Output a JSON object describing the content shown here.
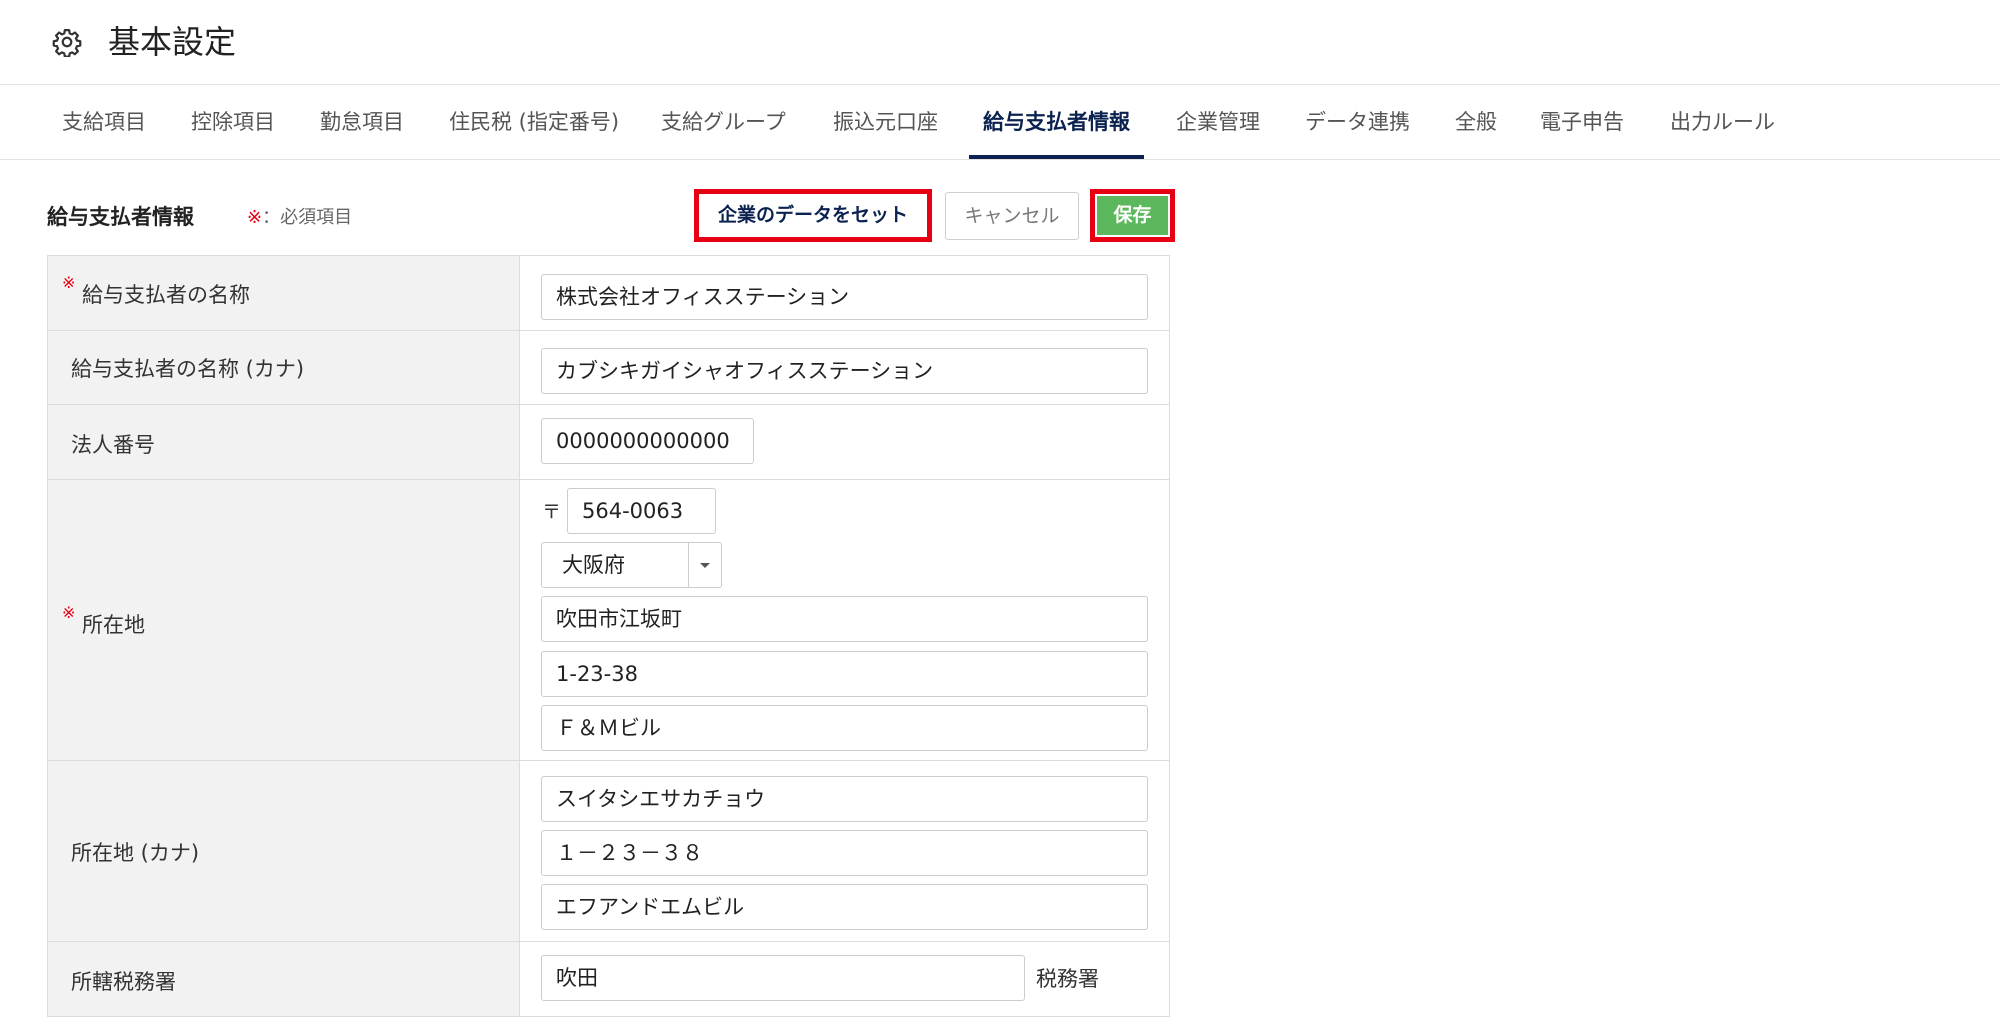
{
  "header": {
    "title": "基本設定",
    "icon": "gear-icon"
  },
  "tabs": [
    {
      "label": "支給項目"
    },
    {
      "label": "控除項目"
    },
    {
      "label": "勤怠項目"
    },
    {
      "label": "住民税 (指定番号)"
    },
    {
      "label": "支給グループ"
    },
    {
      "label": "振込元口座"
    },
    {
      "label": "給与支払者情報",
      "active": true
    },
    {
      "label": "企業管理"
    },
    {
      "label": "データ連携"
    },
    {
      "label": "全般"
    },
    {
      "label": "電子申告"
    },
    {
      "label": "出力ルール"
    }
  ],
  "section": {
    "title": "給与支払者情報",
    "required_mark": "※",
    "required_text": "：必須項目"
  },
  "buttons": {
    "set_company_data": "企業のデータをセット",
    "cancel": "キャンセル",
    "save": "保存"
  },
  "form": {
    "name": {
      "label": "給与支払者の名称",
      "required_mark": "※",
      "value": "株式会社オフィスステーション"
    },
    "name_kana": {
      "label": "給与支払者の名称 (カナ)",
      "value": "カブシキガイシャオフィスステーション"
    },
    "corporate_number": {
      "label": "法人番号",
      "value": "0000000000000"
    },
    "address": {
      "label": "所在地",
      "required_mark": "※",
      "postal_mark": "〒",
      "postal_code": "564-0063",
      "prefecture": "大阪府",
      "line1": "吹田市江坂町",
      "line2": "1-23-38",
      "line3": "Ｆ＆Ｍビル"
    },
    "address_kana": {
      "label": "所在地 (カナ)",
      "line1": "スイタシエサカチョウ",
      "line2": "１－２３－３８",
      "line3": "エフアンドエムビル"
    },
    "tax_office": {
      "label": "所轄税務署",
      "value": "吹田",
      "suffix": "税務署"
    }
  },
  "colors": {
    "accent_navy": "#0b2250",
    "highlight_red": "#e60012",
    "save_green": "#5cb85c"
  }
}
